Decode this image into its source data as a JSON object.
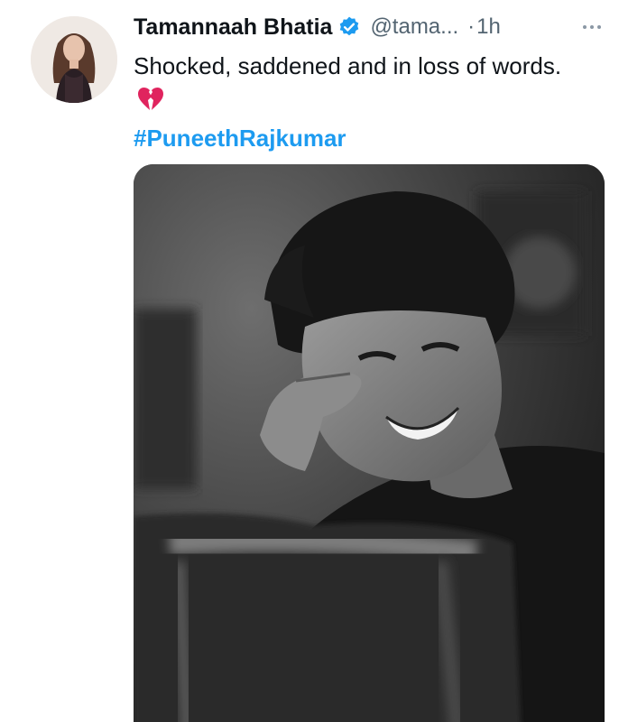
{
  "tweet": {
    "author_name": "Tamannaah Bhatia",
    "handle": "@tama...",
    "separator": "·",
    "time": "1h",
    "text": "Shocked, saddened and in loss of words.",
    "hashtag": "#PuneethRajkumar",
    "emoji_icon": "broken-heart-icon",
    "avatar_icon": "profile-photo",
    "media_icon": "black-and-white-portrait-photo"
  },
  "colors": {
    "verified_blue": "#1d9bf0",
    "hashtag_blue": "#1d9bf0",
    "name_text": "#0f1419",
    "secondary_text": "#536471",
    "heart_red": "#e0245e"
  }
}
